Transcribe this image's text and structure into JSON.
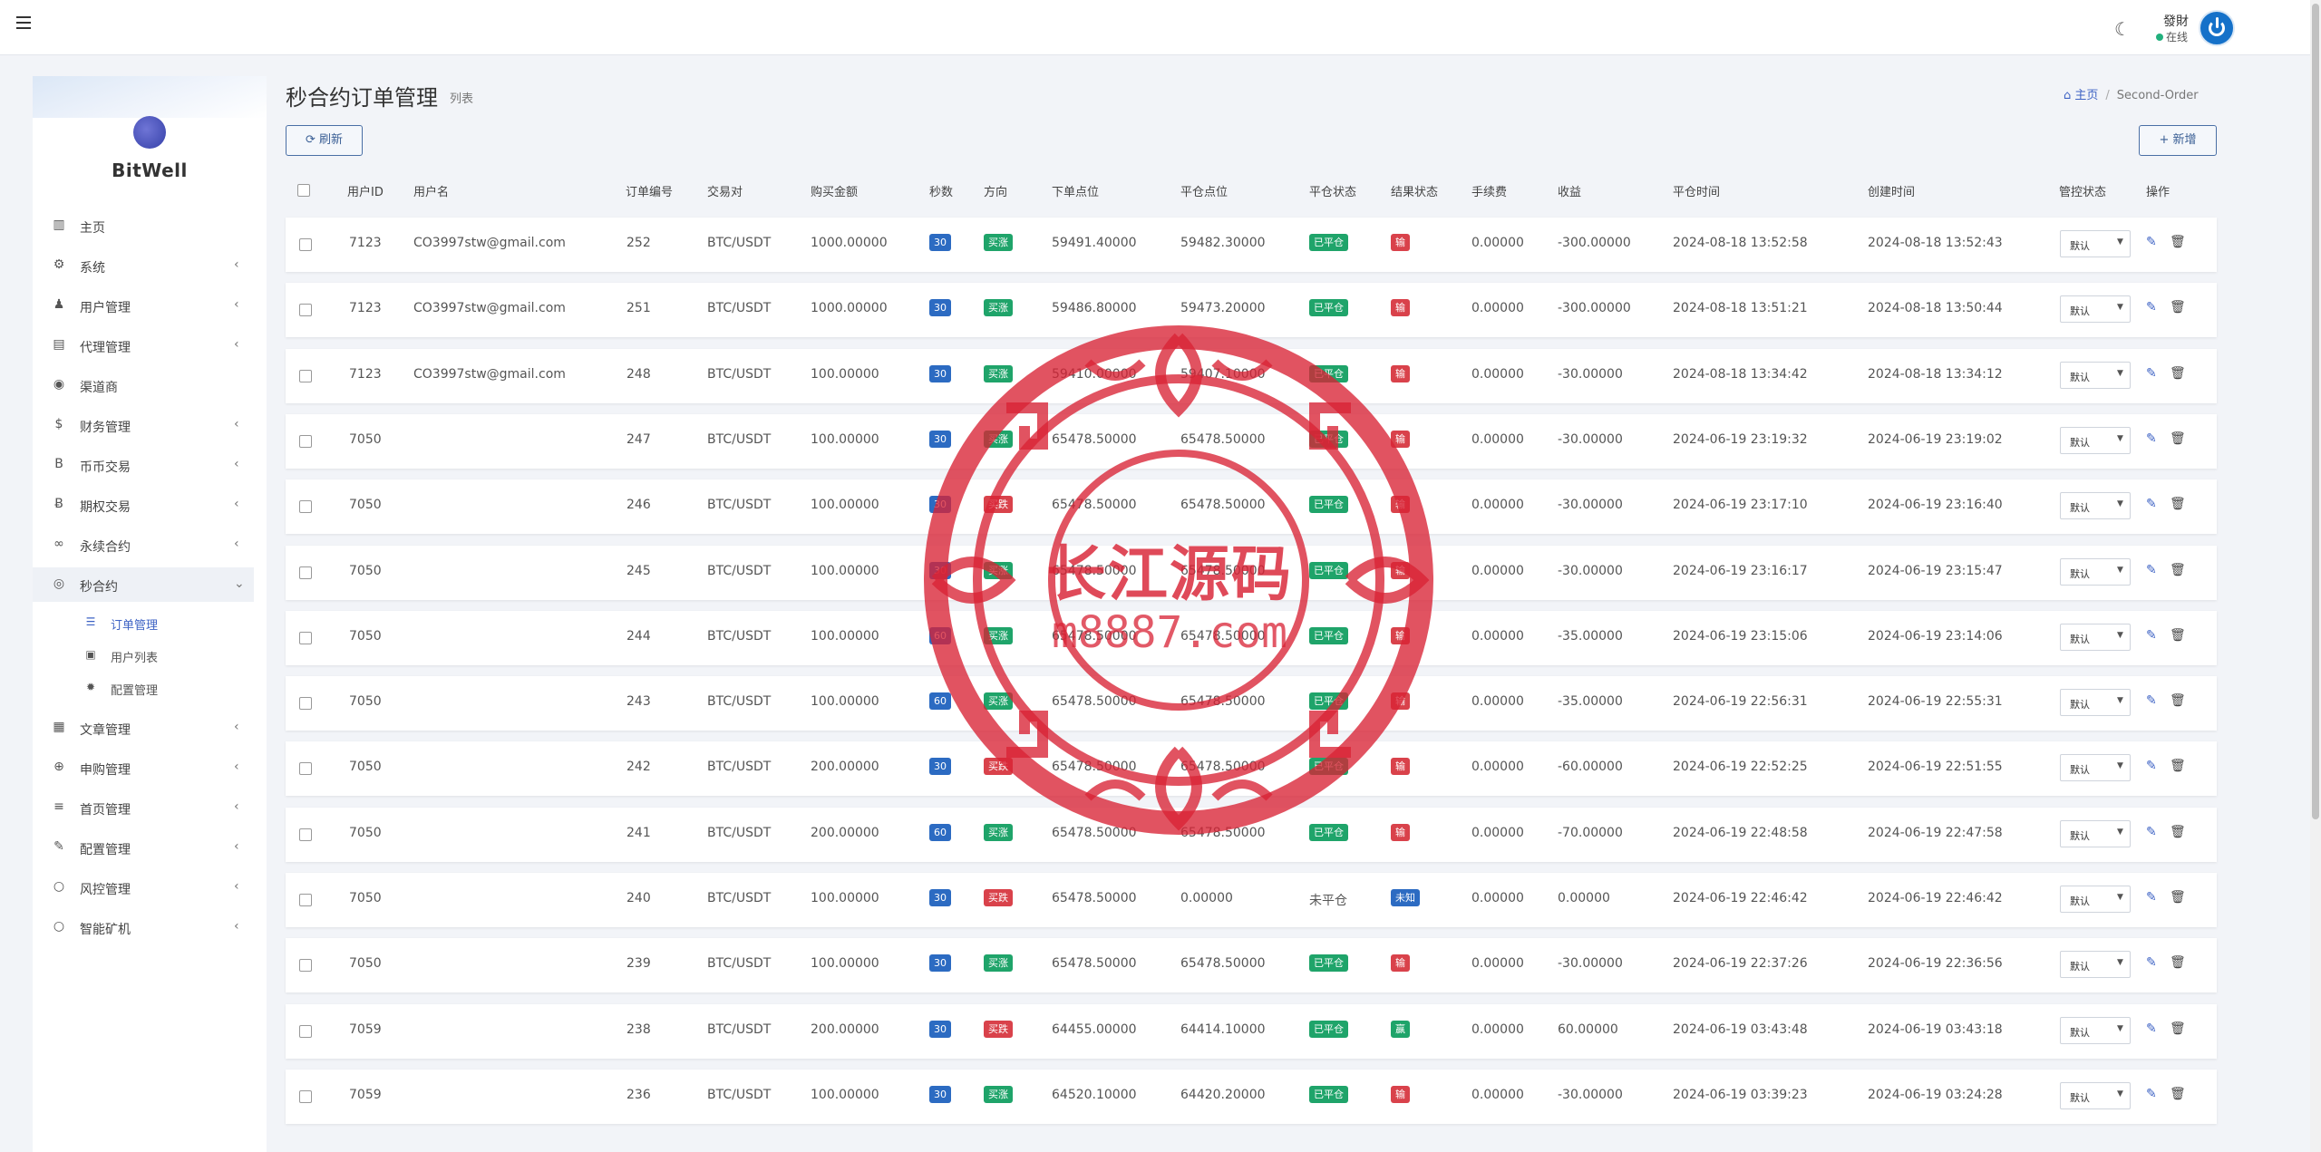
{
  "topbar": {
    "user_name": "發財",
    "user_status": "在线"
  },
  "sidebar": {
    "brand": "BitWell",
    "items": [
      {
        "label": "主页",
        "icon": "dashboard-icon",
        "chevron": false
      },
      {
        "label": "系统",
        "icon": "gear-icon",
        "chevron": true
      },
      {
        "label": "用户管理",
        "icon": "user-icon",
        "chevron": true
      },
      {
        "label": "代理管理",
        "icon": "id-card-icon",
        "chevron": true
      },
      {
        "label": "渠道商",
        "icon": "user-circle-icon",
        "chevron": false
      },
      {
        "label": "财务管理",
        "icon": "dollar-icon",
        "chevron": true
      },
      {
        "label": "币币交易",
        "icon": "bitcoin-icon",
        "chevron": true
      },
      {
        "label": "期权交易",
        "icon": "bitcoin-circle-icon",
        "chevron": true
      },
      {
        "label": "永续合约",
        "icon": "link-icon",
        "chevron": true
      },
      {
        "label": "秒合约",
        "icon": "target-icon",
        "chevron": true,
        "expanded": true
      }
    ],
    "subitems": [
      {
        "label": "订单管理",
        "icon": "list-icon",
        "active": true
      },
      {
        "label": "用户列表",
        "icon": "user-box-icon",
        "active": false
      },
      {
        "label": "配置管理",
        "icon": "cog-icon",
        "active": false
      }
    ],
    "items_after": [
      {
        "label": "文章管理",
        "icon": "newspaper-icon",
        "chevron": true
      },
      {
        "label": "申购管理",
        "icon": "globe-icon",
        "chevron": true
      },
      {
        "label": "首页管理",
        "icon": "bars-icon",
        "chevron": true
      },
      {
        "label": "配置管理",
        "icon": "wrench-icon",
        "chevron": true
      },
      {
        "label": "风控管理",
        "icon": "circle-icon",
        "chevron": true
      },
      {
        "label": "智能矿机",
        "icon": "circle-icon",
        "chevron": true
      }
    ]
  },
  "header": {
    "title": "秒合约订单管理",
    "subtitle": "列表",
    "breadcrumb_home": "主页",
    "breadcrumb_current": "Second-Order",
    "refresh_label": "刷新",
    "add_label": "新增"
  },
  "table": {
    "columns": [
      "用户ID",
      "用户名",
      "订单编号",
      "交易对",
      "购买金额",
      "秒数",
      "方向",
      "下单点位",
      "平仓点位",
      "平仓状态",
      "结果状态",
      "手续费",
      "收益",
      "平仓时间",
      "创建时间",
      "管控状态",
      "操作"
    ],
    "rows": [
      {
        "uid": "7123",
        "username": "CO3997stw@gmail.com",
        "order": "252",
        "pair": "BTC/USDT",
        "amount": "1000.00000",
        "seconds": "30",
        "direction": "买涨",
        "open": "59491.40000",
        "close": "59482.30000",
        "close_status": "已平仓",
        "result": "输",
        "fee": "0.00000",
        "profit": "-300.00000",
        "close_time": "2024-08-18 13:52:58",
        "create_time": "2024-08-18 13:52:43",
        "control": "默认"
      },
      {
        "uid": "7123",
        "username": "CO3997stw@gmail.com",
        "order": "251",
        "pair": "BTC/USDT",
        "amount": "1000.00000",
        "seconds": "30",
        "direction": "买涨",
        "open": "59486.80000",
        "close": "59473.20000",
        "close_status": "已平仓",
        "result": "输",
        "fee": "0.00000",
        "profit": "-300.00000",
        "close_time": "2024-08-18 13:51:21",
        "create_time": "2024-08-18 13:50:44",
        "control": "默认"
      },
      {
        "uid": "7123",
        "username": "CO3997stw@gmail.com",
        "order": "248",
        "pair": "BTC/USDT",
        "amount": "100.00000",
        "seconds": "30",
        "direction": "买涨",
        "open": "59410.00000",
        "close": "59407.10000",
        "close_status": "已平仓",
        "result": "输",
        "fee": "0.00000",
        "profit": "-30.00000",
        "close_time": "2024-08-18 13:34:42",
        "create_time": "2024-08-18 13:34:12",
        "control": "默认"
      },
      {
        "uid": "7050",
        "username": "",
        "order": "247",
        "pair": "BTC/USDT",
        "amount": "100.00000",
        "seconds": "30",
        "direction": "买涨",
        "open": "65478.50000",
        "close": "65478.50000",
        "close_status": "已平仓",
        "result": "输",
        "fee": "0.00000",
        "profit": "-30.00000",
        "close_time": "2024-06-19 23:19:32",
        "create_time": "2024-06-19 23:19:02",
        "control": "默认"
      },
      {
        "uid": "7050",
        "username": "",
        "order": "246",
        "pair": "BTC/USDT",
        "amount": "100.00000",
        "seconds": "30",
        "direction": "买跌",
        "open": "65478.50000",
        "close": "65478.50000",
        "close_status": "已平仓",
        "result": "输",
        "fee": "0.00000",
        "profit": "-30.00000",
        "close_time": "2024-06-19 23:17:10",
        "create_time": "2024-06-19 23:16:40",
        "control": "默认"
      },
      {
        "uid": "7050",
        "username": "",
        "order": "245",
        "pair": "BTC/USDT",
        "amount": "100.00000",
        "seconds": "30",
        "direction": "买涨",
        "open": "65478.50000",
        "close": "65478.50000",
        "close_status": "已平仓",
        "result": "输",
        "fee": "0.00000",
        "profit": "-30.00000",
        "close_time": "2024-06-19 23:16:17",
        "create_time": "2024-06-19 23:15:47",
        "control": "默认"
      },
      {
        "uid": "7050",
        "username": "",
        "order": "244",
        "pair": "BTC/USDT",
        "amount": "100.00000",
        "seconds": "60",
        "direction": "买涨",
        "open": "65478.50000",
        "close": "65478.50000",
        "close_status": "已平仓",
        "result": "输",
        "fee": "0.00000",
        "profit": "-35.00000",
        "close_time": "2024-06-19 23:15:06",
        "create_time": "2024-06-19 23:14:06",
        "control": "默认"
      },
      {
        "uid": "7050",
        "username": "",
        "order": "243",
        "pair": "BTC/USDT",
        "amount": "100.00000",
        "seconds": "60",
        "direction": "买涨",
        "open": "65478.50000",
        "close": "65478.50000",
        "close_status": "已平仓",
        "result": "输",
        "fee": "0.00000",
        "profit": "-35.00000",
        "close_time": "2024-06-19 22:56:31",
        "create_time": "2024-06-19 22:55:31",
        "control": "默认"
      },
      {
        "uid": "7050",
        "username": "",
        "order": "242",
        "pair": "BTC/USDT",
        "amount": "200.00000",
        "seconds": "30",
        "direction": "买跌",
        "open": "65478.50000",
        "close": "65478.50000",
        "close_status": "已平仓",
        "result": "输",
        "fee": "0.00000",
        "profit": "-60.00000",
        "close_time": "2024-06-19 22:52:25",
        "create_time": "2024-06-19 22:51:55",
        "control": "默认"
      },
      {
        "uid": "7050",
        "username": "",
        "order": "241",
        "pair": "BTC/USDT",
        "amount": "200.00000",
        "seconds": "60",
        "direction": "买涨",
        "open": "65478.50000",
        "close": "65478.50000",
        "close_status": "已平仓",
        "result": "输",
        "fee": "0.00000",
        "profit": "-70.00000",
        "close_time": "2024-06-19 22:48:58",
        "create_time": "2024-06-19 22:47:58",
        "control": "默认"
      },
      {
        "uid": "7050",
        "username": "",
        "order": "240",
        "pair": "BTC/USDT",
        "amount": "100.00000",
        "seconds": "30",
        "direction": "买跌",
        "open": "65478.50000",
        "close": "0.00000",
        "close_status": "未平仓",
        "result": "未知",
        "fee": "0.00000",
        "profit": "0.00000",
        "close_time": "2024-06-19 22:46:42",
        "create_time": "2024-06-19 22:46:42",
        "control": "默认"
      },
      {
        "uid": "7050",
        "username": "",
        "order": "239",
        "pair": "BTC/USDT",
        "amount": "100.00000",
        "seconds": "30",
        "direction": "买涨",
        "open": "65478.50000",
        "close": "65478.50000",
        "close_status": "已平仓",
        "result": "输",
        "fee": "0.00000",
        "profit": "-30.00000",
        "close_time": "2024-06-19 22:37:26",
        "create_time": "2024-06-19 22:36:56",
        "control": "默认"
      },
      {
        "uid": "7059",
        "username": "",
        "order": "238",
        "pair": "BTC/USDT",
        "amount": "200.00000",
        "seconds": "30",
        "direction": "买跌",
        "open": "64455.00000",
        "close": "64414.10000",
        "close_status": "已平仓",
        "result": "赢",
        "fee": "0.00000",
        "profit": "60.00000",
        "close_time": "2024-06-19 03:43:48",
        "create_time": "2024-06-19 03:43:18",
        "control": "默认"
      },
      {
        "uid": "7059",
        "username": "",
        "order": "236",
        "pair": "BTC/USDT",
        "amount": "100.00000",
        "seconds": "30",
        "direction": "买涨",
        "open": "64520.10000",
        "close": "64420.20000",
        "close_status": "已平仓",
        "result": "输",
        "fee": "0.00000",
        "profit": "-30.00000",
        "close_time": "2024-06-19 03:39:23",
        "create_time": "2024-06-19 03:24:28",
        "control": "默认"
      }
    ]
  },
  "watermark": {
    "title": "长江源码",
    "url": "m8887.com"
  },
  "colors": {
    "accent": "#3d62c4",
    "up": "#1fa46a",
    "down": "#d9424b",
    "seconds": "#2c6bc2",
    "stamp": "#d82234"
  }
}
